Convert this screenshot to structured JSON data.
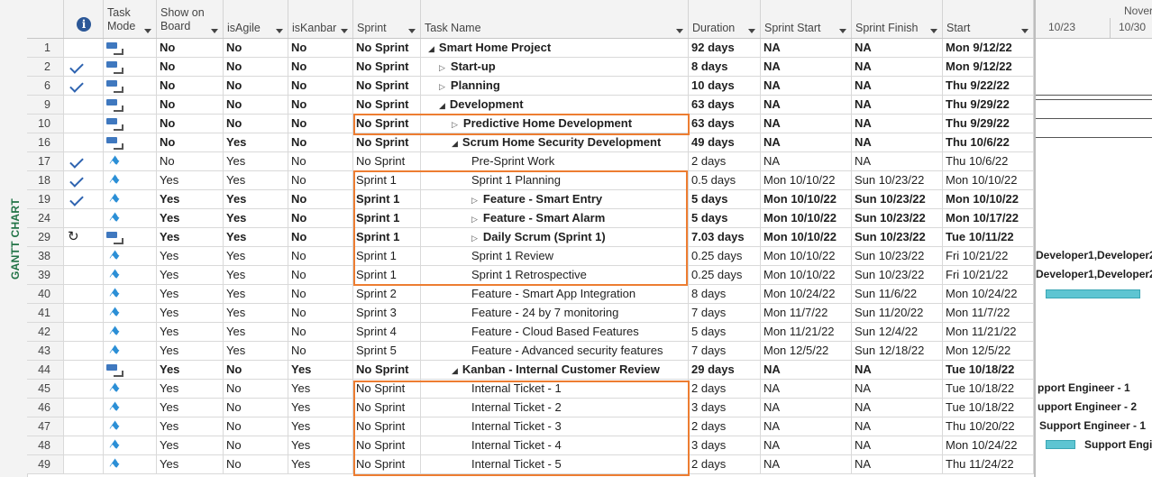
{
  "view_label": "GANTT CHART",
  "columns": {
    "info": "",
    "task_mode": "Task\nMode",
    "show_on_board": "Show on\nBoard",
    "is_agile": "isAgile",
    "is_kanban": "isKanbar",
    "sprint": "Sprint",
    "task_name": "Task Name",
    "duration": "Duration",
    "sprint_start": "Sprint Start",
    "sprint_finish": "Sprint Finish",
    "start": "Start"
  },
  "rows": [
    {
      "id": "1",
      "indicator": "none",
      "mode": "auto",
      "show": "No",
      "agile": "No",
      "kanban": "No",
      "sprint": "No Sprint",
      "name": "Smart Home Project",
      "outline": "down",
      "level": 0,
      "duration": "92 days",
      "sprint_start": "NA",
      "sprint_finish": "NA",
      "start": "Mon 9/12/22",
      "bold": true
    },
    {
      "id": "2",
      "indicator": "check",
      "mode": "auto",
      "show": "No",
      "agile": "No",
      "kanban": "No",
      "sprint": "No Sprint",
      "name": "Start-up",
      "outline": "right",
      "level": 1,
      "duration": "8 days",
      "sprint_start": "NA",
      "sprint_finish": "NA",
      "start": "Mon 9/12/22",
      "bold": true
    },
    {
      "id": "6",
      "indicator": "check",
      "mode": "auto",
      "show": "No",
      "agile": "No",
      "kanban": "No",
      "sprint": "No Sprint",
      "name": "Planning",
      "outline": "right",
      "level": 1,
      "duration": "10 days",
      "sprint_start": "NA",
      "sprint_finish": "NA",
      "start": "Thu 9/22/22",
      "bold": true
    },
    {
      "id": "9",
      "indicator": "none",
      "mode": "auto",
      "show": "No",
      "agile": "No",
      "kanban": "No",
      "sprint": "No Sprint",
      "name": "Development",
      "outline": "down",
      "level": 1,
      "duration": "63 days",
      "sprint_start": "NA",
      "sprint_finish": "NA",
      "start": "Thu 9/29/22",
      "bold": true
    },
    {
      "id": "10",
      "indicator": "none",
      "mode": "auto",
      "show": "No",
      "agile": "No",
      "kanban": "No",
      "sprint": "No Sprint",
      "name": "Predictive Home Development",
      "outline": "right",
      "level": 2,
      "duration": "63 days",
      "sprint_start": "NA",
      "sprint_finish": "NA",
      "start": "Thu 9/29/22",
      "bold": true
    },
    {
      "id": "16",
      "indicator": "none",
      "mode": "auto",
      "show": "No",
      "agile": "Yes",
      "kanban": "No",
      "sprint": "No Sprint",
      "name": "Scrum Home Security Development",
      "outline": "down",
      "level": 2,
      "duration": "49 days",
      "sprint_start": "NA",
      "sprint_finish": "NA",
      "start": "Thu 10/6/22",
      "bold": true
    },
    {
      "id": "17",
      "indicator": "check",
      "mode": "manual",
      "show": "No",
      "agile": "Yes",
      "kanban": "No",
      "sprint": "No Sprint",
      "name": "Pre-Sprint Work",
      "outline": "none",
      "level": 3,
      "duration": "2 days",
      "sprint_start": "NA",
      "sprint_finish": "NA",
      "start": "Thu 10/6/22",
      "bold": false
    },
    {
      "id": "18",
      "indicator": "check",
      "mode": "manual",
      "show": "Yes",
      "agile": "Yes",
      "kanban": "No",
      "sprint": "Sprint 1",
      "name": "Sprint 1 Planning",
      "outline": "none",
      "level": 3,
      "duration": "0.5 days",
      "sprint_start": "Mon 10/10/22",
      "sprint_finish": "Sun 10/23/22",
      "start": "Mon 10/10/22",
      "bold": false
    },
    {
      "id": "19",
      "indicator": "check",
      "mode": "manual",
      "show": "Yes",
      "agile": "Yes",
      "kanban": "No",
      "sprint": "Sprint 1",
      "name": "Feature - Smart Entry",
      "outline": "right",
      "level": 3,
      "duration": "5 days",
      "sprint_start": "Mon 10/10/22",
      "sprint_finish": "Sun 10/23/22",
      "start": "Mon 10/10/22",
      "bold": true
    },
    {
      "id": "24",
      "indicator": "none",
      "mode": "manual",
      "show": "Yes",
      "agile": "Yes",
      "kanban": "No",
      "sprint": "Sprint 1",
      "name": "Feature - Smart Alarm",
      "outline": "right",
      "level": 3,
      "duration": "5 days",
      "sprint_start": "Mon 10/10/22",
      "sprint_finish": "Sun 10/23/22",
      "start": "Mon 10/17/22",
      "bold": true
    },
    {
      "id": "29",
      "indicator": "recur",
      "mode": "auto",
      "show": "Yes",
      "agile": "Yes",
      "kanban": "No",
      "sprint": "Sprint 1",
      "name": "Daily Scrum (Sprint 1)",
      "outline": "right",
      "level": 3,
      "duration": "7.03 days",
      "sprint_start": "Mon 10/10/22",
      "sprint_finish": "Sun 10/23/22",
      "start": "Tue 10/11/22",
      "bold": true
    },
    {
      "id": "38",
      "indicator": "none",
      "mode": "manual",
      "show": "Yes",
      "agile": "Yes",
      "kanban": "No",
      "sprint": "Sprint 1",
      "name": "Sprint 1 Review",
      "outline": "none",
      "level": 3,
      "duration": "0.25 days",
      "sprint_start": "Mon 10/10/22",
      "sprint_finish": "Sun 10/23/22",
      "start": "Fri 10/21/22",
      "bold": false
    },
    {
      "id": "39",
      "indicator": "none",
      "mode": "manual",
      "show": "Yes",
      "agile": "Yes",
      "kanban": "No",
      "sprint": "Sprint 1",
      "name": "Sprint 1 Retrospective",
      "outline": "none",
      "level": 3,
      "duration": "0.25 days",
      "sprint_start": "Mon 10/10/22",
      "sprint_finish": "Sun 10/23/22",
      "start": "Fri 10/21/22",
      "bold": false
    },
    {
      "id": "40",
      "indicator": "none",
      "mode": "manual",
      "show": "Yes",
      "agile": "Yes",
      "kanban": "No",
      "sprint": "Sprint 2",
      "name": "Feature - Smart App Integration",
      "outline": "none",
      "level": 3,
      "duration": "8 days",
      "sprint_start": "Mon 10/24/22",
      "sprint_finish": "Sun 11/6/22",
      "start": "Mon 10/24/22",
      "bold": false
    },
    {
      "id": "41",
      "indicator": "none",
      "mode": "manual",
      "show": "Yes",
      "agile": "Yes",
      "kanban": "No",
      "sprint": "Sprint 3",
      "name": "Feature - 24 by 7 monitoring",
      "outline": "none",
      "level": 3,
      "duration": "7 days",
      "sprint_start": "Mon 11/7/22",
      "sprint_finish": "Sun 11/20/22",
      "start": "Mon 11/7/22",
      "bold": false
    },
    {
      "id": "42",
      "indicator": "none",
      "mode": "manual",
      "show": "Yes",
      "agile": "Yes",
      "kanban": "No",
      "sprint": "Sprint 4",
      "name": "Feature - Cloud Based Features",
      "outline": "none",
      "level": 3,
      "duration": "5 days",
      "sprint_start": "Mon 11/21/22",
      "sprint_finish": "Sun 12/4/22",
      "start": "Mon 11/21/22",
      "bold": false
    },
    {
      "id": "43",
      "indicator": "none",
      "mode": "manual",
      "show": "Yes",
      "agile": "Yes",
      "kanban": "No",
      "sprint": "Sprint 5",
      "name": "Feature - Advanced security features",
      "outline": "none",
      "level": 3,
      "duration": "7 days",
      "sprint_start": "Mon 12/5/22",
      "sprint_finish": "Sun 12/18/22",
      "start": "Mon 12/5/22",
      "bold": false
    },
    {
      "id": "44",
      "indicator": "none",
      "mode": "auto",
      "show": "Yes",
      "agile": "No",
      "kanban": "Yes",
      "sprint": "No Sprint",
      "name": "Kanban - Internal Customer Review",
      "outline": "down",
      "level": 2,
      "duration": "29 days",
      "sprint_start": "NA",
      "sprint_finish": "NA",
      "start": "Tue 10/18/22",
      "bold": true
    },
    {
      "id": "45",
      "indicator": "none",
      "mode": "manual",
      "show": "Yes",
      "agile": "No",
      "kanban": "Yes",
      "sprint": "No Sprint",
      "name": "Internal Ticket - 1",
      "outline": "none",
      "level": 3,
      "duration": "2 days",
      "sprint_start": "NA",
      "sprint_finish": "NA",
      "start": "Tue 10/18/22",
      "bold": false
    },
    {
      "id": "46",
      "indicator": "none",
      "mode": "manual",
      "show": "Yes",
      "agile": "No",
      "kanban": "Yes",
      "sprint": "No Sprint",
      "name": "Internal Ticket - 2",
      "outline": "none",
      "level": 3,
      "duration": "3 days",
      "sprint_start": "NA",
      "sprint_finish": "NA",
      "start": "Tue 10/18/22",
      "bold": false
    },
    {
      "id": "47",
      "indicator": "none",
      "mode": "manual",
      "show": "Yes",
      "agile": "No",
      "kanban": "Yes",
      "sprint": "No Sprint",
      "name": "Internal Ticket - 3",
      "outline": "none",
      "level": 3,
      "duration": "2 days",
      "sprint_start": "NA",
      "sprint_finish": "NA",
      "start": "Thu 10/20/22",
      "bold": false
    },
    {
      "id": "48",
      "indicator": "none",
      "mode": "manual",
      "show": "Yes",
      "agile": "No",
      "kanban": "Yes",
      "sprint": "No Sprint",
      "name": "Internal Ticket - 4",
      "outline": "none",
      "level": 3,
      "duration": "3 days",
      "sprint_start": "NA",
      "sprint_finish": "NA",
      "start": "Mon 10/24/22",
      "bold": false
    },
    {
      "id": "49",
      "indicator": "none",
      "mode": "manual",
      "show": "Yes",
      "agile": "No",
      "kanban": "Yes",
      "sprint": "No Sprint",
      "name": "Internal Ticket - 5",
      "outline": "none",
      "level": 3,
      "duration": "2 days",
      "sprint_start": "NA",
      "sprint_finish": "NA",
      "start": "Thu 11/24/22",
      "bold": false
    }
  ],
  "gantt": {
    "month_label": "Nover",
    "week_labels": [
      "10/23",
      "10/30"
    ],
    "resource_labels": [
      "Developer1,Developer2,",
      "Developer1,Developer2,",
      "pport Engineer - 1",
      "upport Engineer - 2",
      "Support Engineer - 1",
      "Support Engin"
    ]
  },
  "colors": {
    "highlight": "#ed7d31",
    "view_label": "#217346",
    "gantt_bar": "#5ec5d2",
    "check": "#2e63b0",
    "manual_pin": "#2b8fd6"
  }
}
